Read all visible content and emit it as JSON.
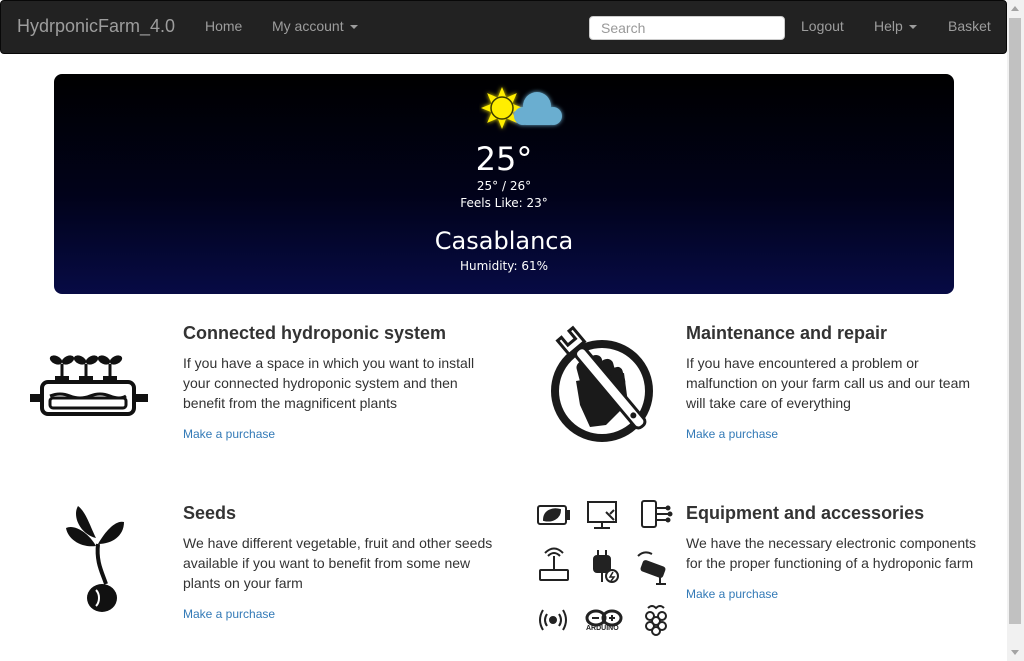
{
  "navbar": {
    "brand": "HydrponicFarm_4.0",
    "home": "Home",
    "my_account": "My account",
    "search_placeholder": "Search",
    "logout": "Logout",
    "help": "Help",
    "basket": "Basket"
  },
  "weather": {
    "icon": "sun-behind-cloud-icon",
    "temperature": "25°",
    "min_max": "25° / 26°",
    "feels_like": "Feels Like: 23°",
    "city": "Casablanca",
    "humidity": "Humidity: 61%"
  },
  "services": [
    {
      "title": "Connected hydroponic system",
      "description": "If you have a space in which you want to install your connected hydroponic system and then benefit from the magnificent plants",
      "link": "Make a purchase",
      "icon": "hydroponic-tray-icon"
    },
    {
      "title": "Maintenance and repair",
      "description": "If you have encountered a problem or malfunction on your farm call us and our team will take care of everything",
      "link": "Make a purchase",
      "icon": "fist-wrench-icon"
    },
    {
      "title": "Seeds",
      "description": "We have different vegetable, fruit and other seeds available if you want to benefit from some new plants on your farm",
      "link": "Make a purchase",
      "icon": "sprouting-seed-icon"
    },
    {
      "title": "Equipment and accessories",
      "description": "We have the necessary electronic components for the proper functioning of a hydroponic farm",
      "link": "Make a purchase",
      "icon": "electronics-grid-icon",
      "sub_icons": [
        "battery-leaf-icon",
        "touch-monitor-icon",
        "smartphone-circuit-icon",
        "router-icon",
        "power-plug-icon",
        "security-camera-icon",
        "wireless-signal-icon",
        "arduino-logo-icon",
        "raspberry-pi-icon"
      ],
      "arduino_label": "ARDUINO"
    }
  ],
  "colors": {
    "navbar_bg": "#222222",
    "link": "#337ab7",
    "weather_top": "#000000",
    "weather_bottom": "#070b45",
    "sun": "#ffee00",
    "cloud": "#6aaed0"
  }
}
